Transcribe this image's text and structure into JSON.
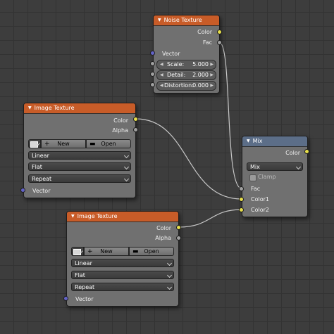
{
  "links_color": "#c8c8c8",
  "noise_texture": {
    "title": "Noise Texture",
    "outputs": [
      "Color",
      "Fac"
    ],
    "inputs": {
      "vector": "Vector",
      "scale": {
        "label": "Scale:",
        "value": "5.000"
      },
      "detail": {
        "label": "Detail:",
        "value": "2.000"
      },
      "distortion": {
        "label": "Distortion:",
        "value": "0.000"
      }
    }
  },
  "image_texture_1": {
    "title": "Image Texture",
    "outputs": [
      "Color",
      "Alpha"
    ],
    "new_label": "New",
    "open_label": "Open",
    "interpolation": "Linear",
    "projection": "Flat",
    "extension": "Repeat",
    "vector": "Vector"
  },
  "image_texture_2": {
    "title": "Image Texture",
    "outputs": [
      "Color",
      "Alpha"
    ],
    "new_label": "New",
    "open_label": "Open",
    "interpolation": "Linear",
    "projection": "Flat",
    "extension": "Repeat",
    "vector": "Vector"
  },
  "mix": {
    "title": "Mix",
    "output": "Color",
    "blend_type": "Mix",
    "clamp_label": "Clamp",
    "inputs": [
      "Fac",
      "Color1",
      "Color2"
    ]
  }
}
